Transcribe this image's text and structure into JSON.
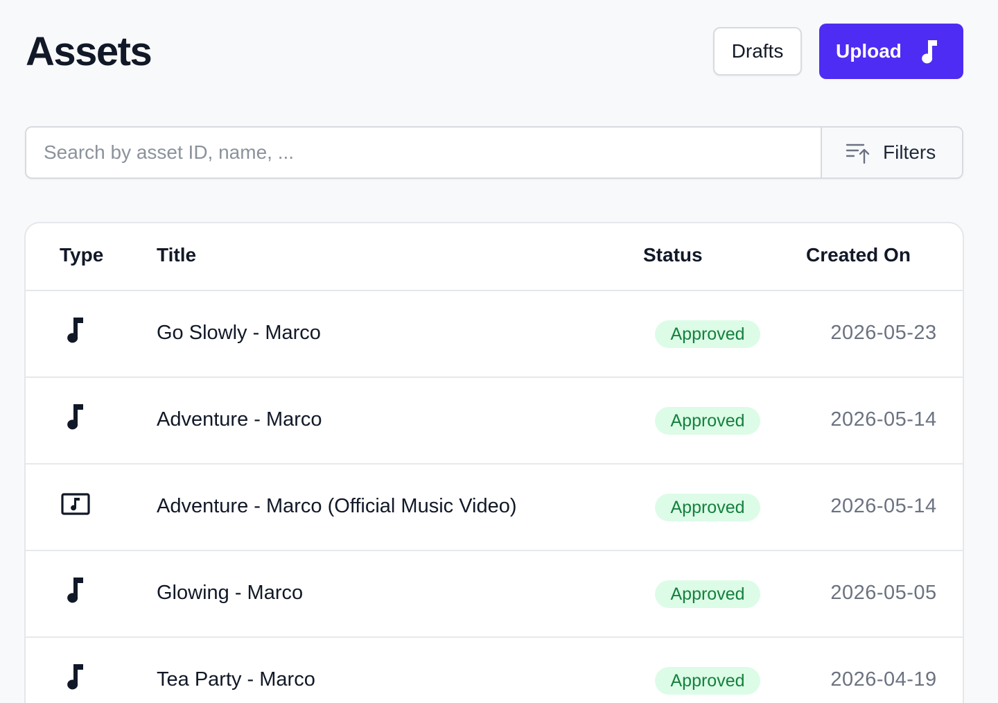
{
  "header": {
    "title": "Assets",
    "drafts_label": "Drafts",
    "upload_label": "Upload",
    "upload_icon": "music-note-icon",
    "accent_color": "#4f2cf3"
  },
  "search": {
    "placeholder": "Search by asset ID, name, ...",
    "value": "",
    "filters_label": "Filters",
    "filters_icon": "sort-filter-icon"
  },
  "table": {
    "columns": {
      "type": "Type",
      "title": "Title",
      "status": "Status",
      "created_on": "Created On"
    },
    "rows": [
      {
        "type_icon": "music-note-icon",
        "title": "Go Slowly - Marco",
        "status": "Approved",
        "created_on": "2026-05-23"
      },
      {
        "type_icon": "music-note-icon",
        "title": "Adventure - Marco",
        "status": "Approved",
        "created_on": "2026-05-14"
      },
      {
        "type_icon": "music-video-icon",
        "title": "Adventure - Marco (Official Music Video)",
        "status": "Approved",
        "created_on": "2026-05-14"
      },
      {
        "type_icon": "music-note-icon",
        "title": "Glowing - Marco",
        "status": "Approved",
        "created_on": "2026-05-05"
      },
      {
        "type_icon": "music-note-icon",
        "title": "Tea Party - Marco",
        "status": "Approved",
        "created_on": "2026-04-19"
      }
    ],
    "status_colors": {
      "approved_bg": "#dcfce7",
      "approved_text": "#15803d"
    }
  }
}
